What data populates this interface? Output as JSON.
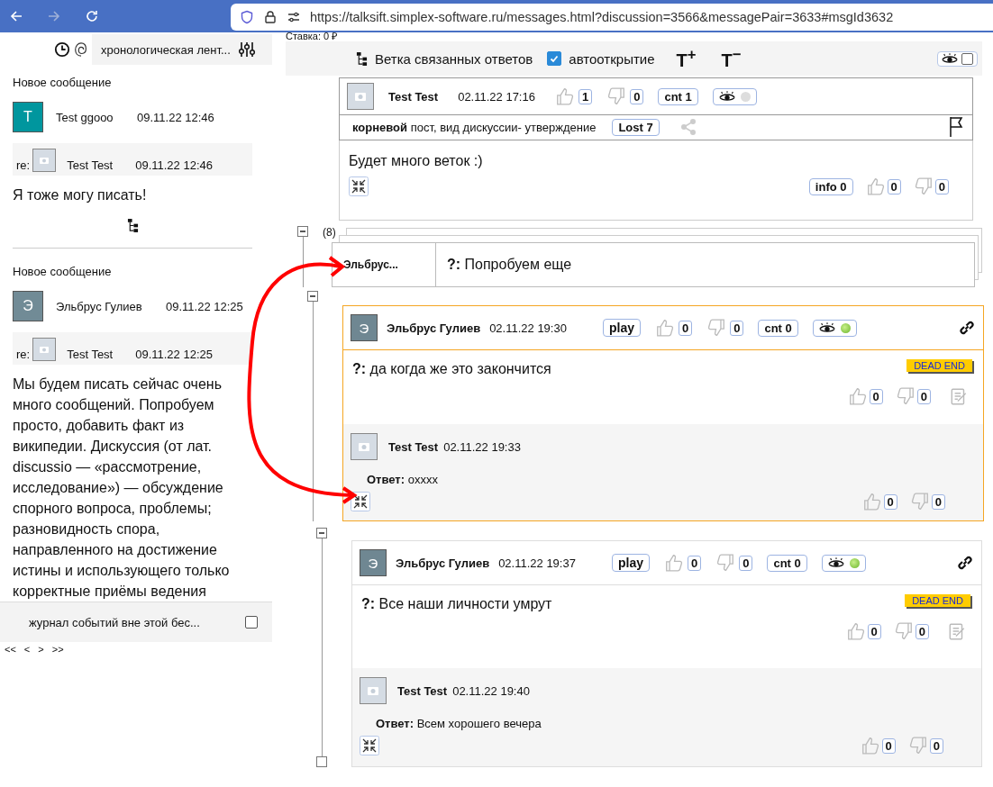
{
  "browser": {
    "url": "https://talksift.simplex-software.ru/messages.html?discussion=3566&messagePair=3633#msgId3632"
  },
  "left_panel": {
    "header": {
      "label": "хронологическая лент..."
    },
    "feed": [
      {
        "title": "Новое сообщение",
        "initial": "T",
        "color": "#00969e",
        "author": "Test ggooo",
        "time": "09.11.22 12:46",
        "reply": {
          "prefix": "re:",
          "author": "Test Test",
          "time": "09.11.22 12:46"
        },
        "text": "Я тоже могу писать!",
        "tree_link": true
      },
      {
        "title": "Новое сообщение",
        "initial": "Э",
        "color": "#718b96",
        "author": "Эльбрус Гулиев",
        "time": "09.11.22 12:25",
        "reply": {
          "prefix": "re:",
          "author": "Test Test",
          "time": "09.11.22 12:25"
        },
        "text": "Мы будем писать сейчас очень много сообщений. Попробуем просто, добавить факт из википедии. Дискуссия (от лат. discussio — «рассмотрение, исследование») — обсуждение спорного вопроса, проблемы; разновидность спора, направленного на достижение истины и использующего только корректные приёмы ведения",
        "tree_link": false
      }
    ],
    "event_log": {
      "label": "журнал событий вне этой бес...",
      "checked": false
    },
    "pager": [
      "<<",
      "<",
      ">",
      ">>"
    ]
  },
  "stake": "Ставка: 0 ₽",
  "toolbar": {
    "branch_label": "Ветка связанных ответов",
    "autoopen": {
      "label": "автооткрытие",
      "checked": true
    },
    "font_buttons": [
      "T$^{+}$",
      "T$^{−}$"
    ],
    "eye_toggle": {
      "checked": false
    }
  },
  "root_post": {
    "author": "Test Test",
    "time": "02.11.22 17:16",
    "likes": "1",
    "dislikes": "0",
    "cnt": "cnt 1",
    "seen": false,
    "meta": "**корневой** пост, вид дискуссии- утверждение",
    "lost": "Lost 7",
    "text": "Будет много веток :)",
    "info": "info 0",
    "body_likes": "0",
    "body_dislikes": "0"
  },
  "collapsed_group": {
    "count": "(8)",
    "author": "Эльбрус...",
    "text": "**?:** Попробуем еще"
  },
  "posts": [
    {
      "selected": true,
      "initial": "Э",
      "author": "Эльбрус Гулиев",
      "time": "02.11.22 19:30",
      "play": "play",
      "likes": "0",
      "dislikes": "0",
      "cnt": "cnt 0",
      "seen": true,
      "question": "**?:** да когда же это закончится",
      "badge": "DEAD END",
      "q_likes": "0",
      "q_dislikes": "0",
      "answer": {
        "author": "Test Test",
        "time": "02.11.22 19:33",
        "text": "**Ответ:** oxxxx",
        "likes": "0",
        "dislikes": "0"
      }
    },
    {
      "selected": false,
      "initial": "Э",
      "author": "Эльбрус Гулиев",
      "time": "02.11.22 19:37",
      "play": "play",
      "likes": "0",
      "dislikes": "0",
      "cnt": "cnt 0",
      "seen": true,
      "question": "**?:** Все наши личности умрут",
      "badge": "DEAD END",
      "q_likes": "0",
      "q_dislikes": "0",
      "answer": {
        "author": "Test Test",
        "time": "02.11.22 19:40",
        "text": "**Ответ:** Всем хорошего вечера",
        "likes": "0",
        "dislikes": "0"
      }
    }
  ]
}
